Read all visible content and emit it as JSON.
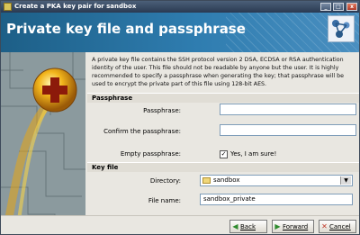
{
  "window": {
    "title": "Create a PKA key pair for sandbox",
    "minimize_glyph": "_",
    "maximize_glyph": "□",
    "close_glyph": "x"
  },
  "header": {
    "title": "Private key file and passphrase"
  },
  "description": "A private key file contains the SSH protocol version 2 DSA, ECDSA or RSA authentication identity of the user. This file should not be readable by anyone but the user. It is highly recommended to specify a passphrase when generating the key; that passphrase will be used to encrypt the private part of this file using 128-bit AES.",
  "passphrase_section": {
    "title": "Passphrase",
    "passphrase_label": "Passphrase:",
    "passphrase_value": "",
    "confirm_label": "Confirm the passphrase:",
    "confirm_value": "",
    "empty_label": "Empty passphrase:",
    "empty_checked": true,
    "empty_checkbox_text": "Yes, I am sure!"
  },
  "keyfile_section": {
    "title": "Key file",
    "directory_label": "Directory:",
    "directory_value": "sandbox",
    "filename_label": "File name:",
    "filename_value": "sandbox_private"
  },
  "buttons": {
    "back": "Back",
    "forward": "Forward",
    "cancel": "Cancel"
  },
  "colors": {
    "header_blue": "#2f7db0",
    "back_icon": "#2e8b2e",
    "cancel_icon": "#c0392b"
  },
  "icons": {
    "app": "key-pair-icon",
    "logo": "ssh-network-icon",
    "directory": "folder-icon",
    "dropdown": "chevron-down-icon",
    "back": "back-arrow-icon",
    "forward": "forward-arrow-icon",
    "cancel": "cancel-x-icon",
    "sidebar": "plus-orb-illustration"
  }
}
